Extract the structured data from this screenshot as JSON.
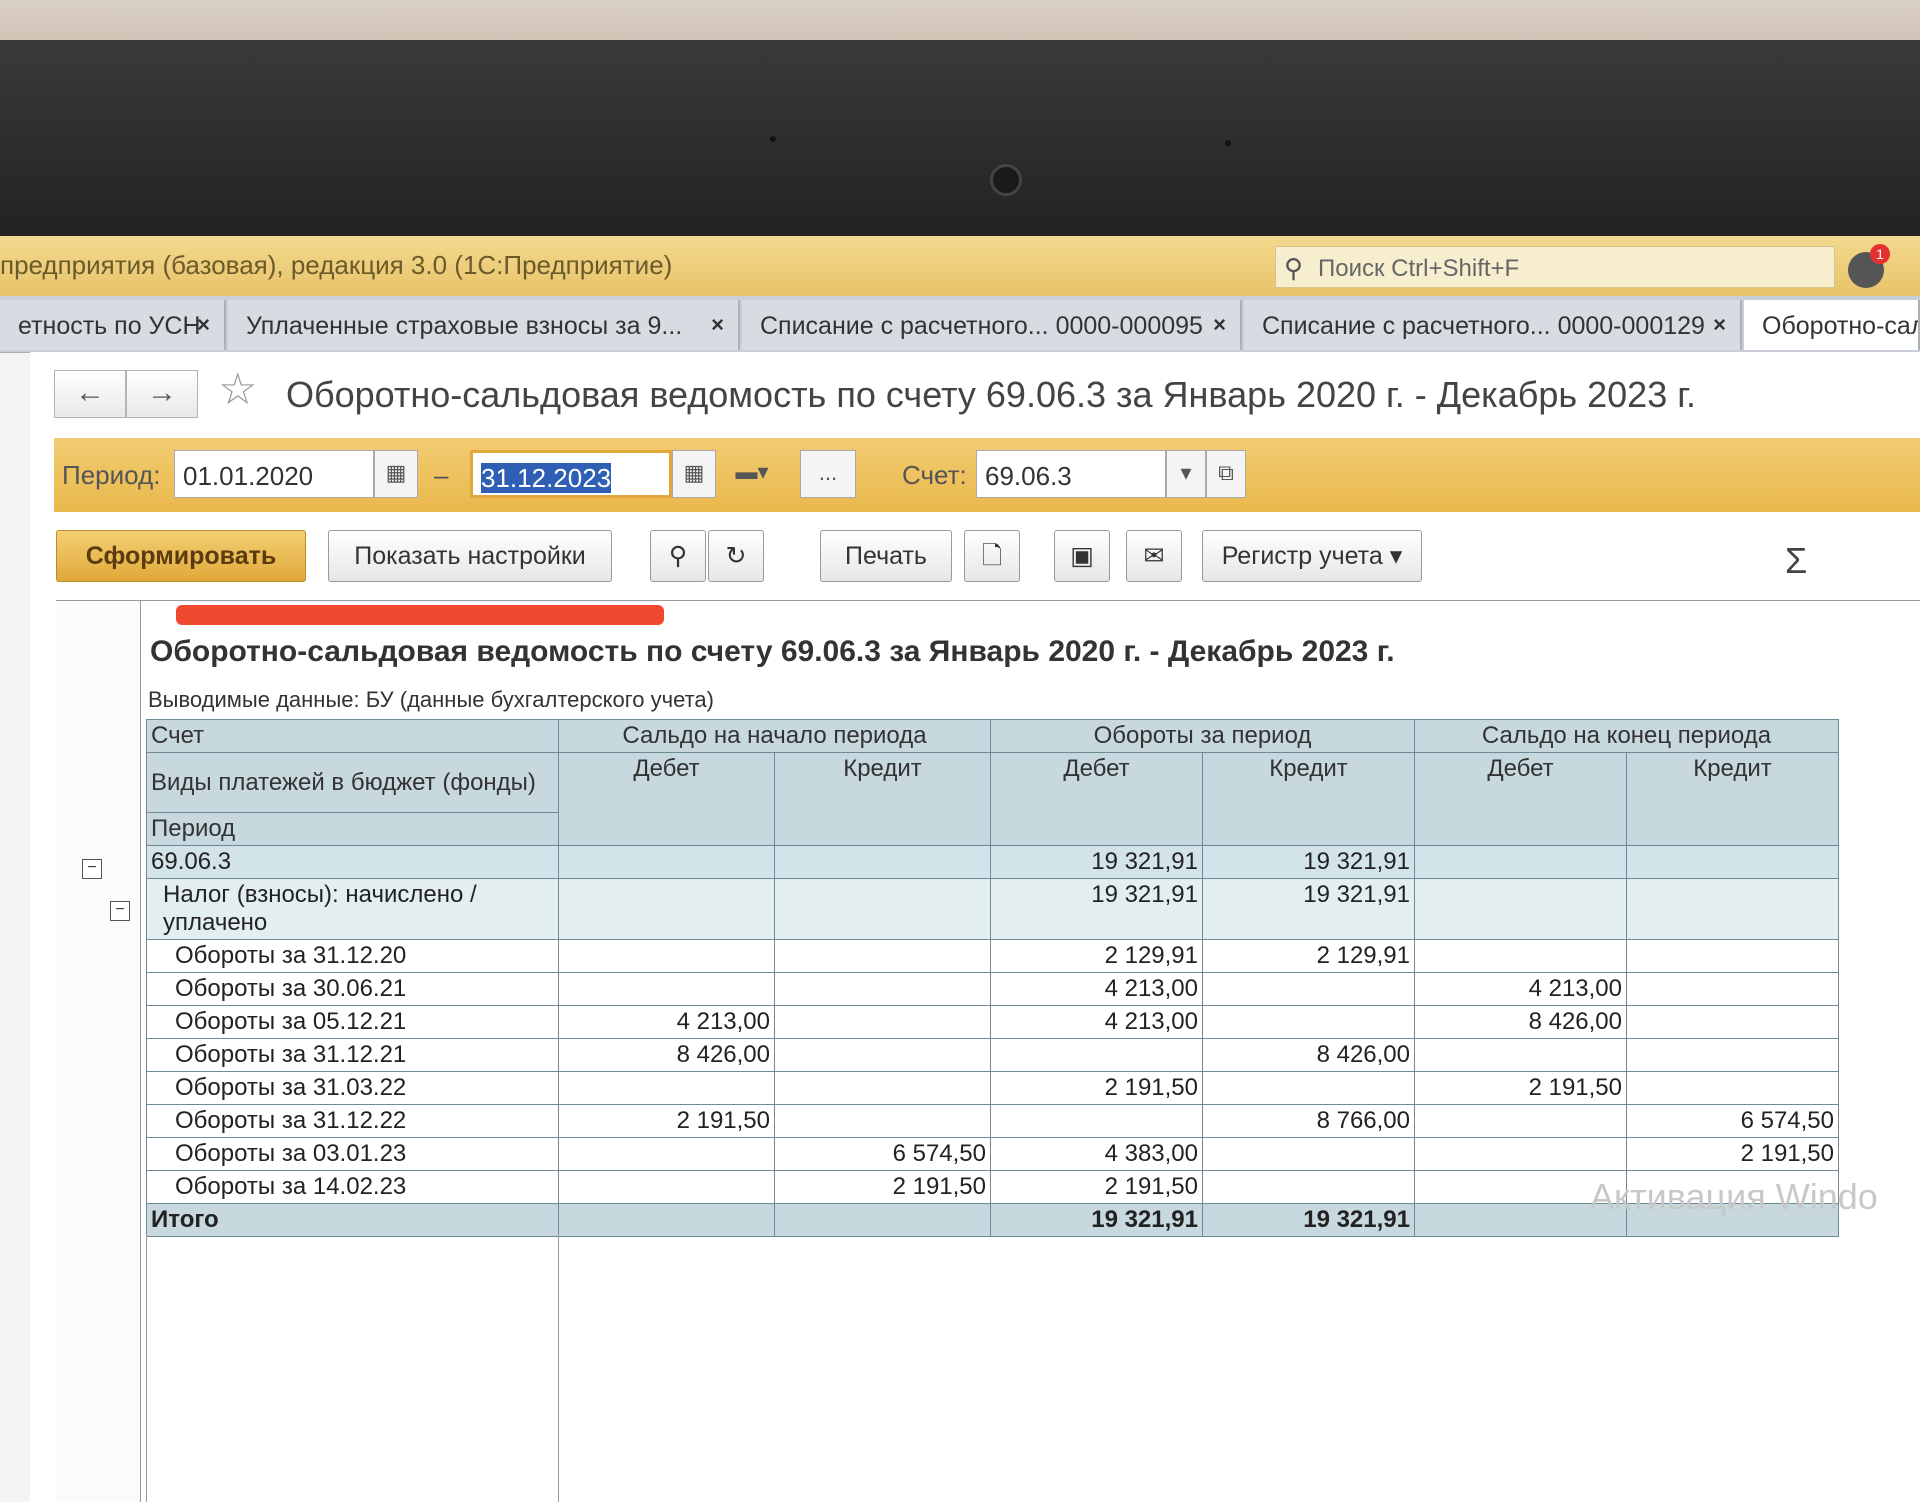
{
  "app": {
    "title": "предприятия (базовая), редакция 3.0  (1С:Предприятие)",
    "search_placeholder": "Поиск Ctrl+Shift+F",
    "notification_count": "1"
  },
  "tabs": [
    {
      "label": "етность по УСН",
      "close": "×"
    },
    {
      "label": "Уплаченные страховые взносы за 9...",
      "close": "×"
    },
    {
      "label": "Списание с расчетного... 0000-000095",
      "close": "×"
    },
    {
      "label": "Списание с расчетного... 0000-000129",
      "close": "×"
    },
    {
      "label": "Оборотно-саль",
      "close": ""
    }
  ],
  "page": {
    "title": "Оборотно-сальдовая ведомость по счету 69.06.3 за Январь 2020 г. - Декабрь 2023 г."
  },
  "filters": {
    "period_label": "Период:",
    "date_from": "01.01.2020",
    "dash": "–",
    "date_to": "31.12.2023",
    "ellipsis": "...",
    "account_label": "Счет:",
    "account_value": "69.06.3"
  },
  "toolbar": {
    "generate": "Сформировать",
    "show_settings": "Показать настройки",
    "print": "Печать",
    "register": "Регистр учета",
    "sigma": "Σ"
  },
  "report": {
    "title": "Оборотно-сальдовая ведомость по счету 69.06.3 за Январь 2020 г. - Декабрь 2023 г.",
    "subtitle": "Выводимые данные: БУ (данные бухгалтерского учета)",
    "headers": {
      "account": "Счет",
      "payment_types": "Виды платежей в бюджет (фонды)",
      "period": "Период",
      "opening": "Сальдо на начало периода",
      "turnover": "Обороты за период",
      "closing": "Сальдо на конец периода",
      "debit": "Дебет",
      "credit": "Кредит"
    },
    "account_row": {
      "name": "69.06.3",
      "turn_debit": "19 321,91",
      "turn_credit": "19 321,91"
    },
    "subgroup_row": {
      "name": "Налог (взносы): начислено / уплачено",
      "turn_debit": "19 321,91",
      "turn_credit": "19 321,91"
    },
    "rows": [
      {
        "period": "Обороты за 31.12.20",
        "open_debit": "",
        "open_credit": "",
        "turn_debit": "2 129,91",
        "turn_credit": "2 129,91",
        "close_debit": "",
        "close_credit": ""
      },
      {
        "period": "Обороты за 30.06.21",
        "open_debit": "",
        "open_credit": "",
        "turn_debit": "4 213,00",
        "turn_credit": "",
        "close_debit": "4 213,00",
        "close_credit": ""
      },
      {
        "period": "Обороты за 05.12.21",
        "open_debit": "4 213,00",
        "open_credit": "",
        "turn_debit": "4 213,00",
        "turn_credit": "",
        "close_debit": "8 426,00",
        "close_credit": ""
      },
      {
        "period": "Обороты за 31.12.21",
        "open_debit": "8 426,00",
        "open_credit": "",
        "turn_debit": "",
        "turn_credit": "8 426,00",
        "close_debit": "",
        "close_credit": ""
      },
      {
        "period": "Обороты за 31.03.22",
        "open_debit": "",
        "open_credit": "",
        "turn_debit": "2 191,50",
        "turn_credit": "",
        "close_debit": "2 191,50",
        "close_credit": ""
      },
      {
        "period": "Обороты за 31.12.22",
        "open_debit": "2 191,50",
        "open_credit": "",
        "turn_debit": "",
        "turn_credit": "8 766,00",
        "close_debit": "",
        "close_credit": "6 574,50"
      },
      {
        "period": "Обороты за 03.01.23",
        "open_debit": "",
        "open_credit": "6 574,50",
        "turn_debit": "4 383,00",
        "turn_credit": "",
        "close_debit": "",
        "close_credit": "2 191,50"
      },
      {
        "period": "Обороты за 14.02.23",
        "open_debit": "",
        "open_credit": "2 191,50",
        "turn_debit": "2 191,50",
        "turn_credit": "",
        "close_debit": "",
        "close_credit": ""
      }
    ],
    "total": {
      "label": "Итого",
      "turn_debit": "19 321,91",
      "turn_credit": "19 321,91"
    }
  },
  "watermark": "Активация Windo"
}
